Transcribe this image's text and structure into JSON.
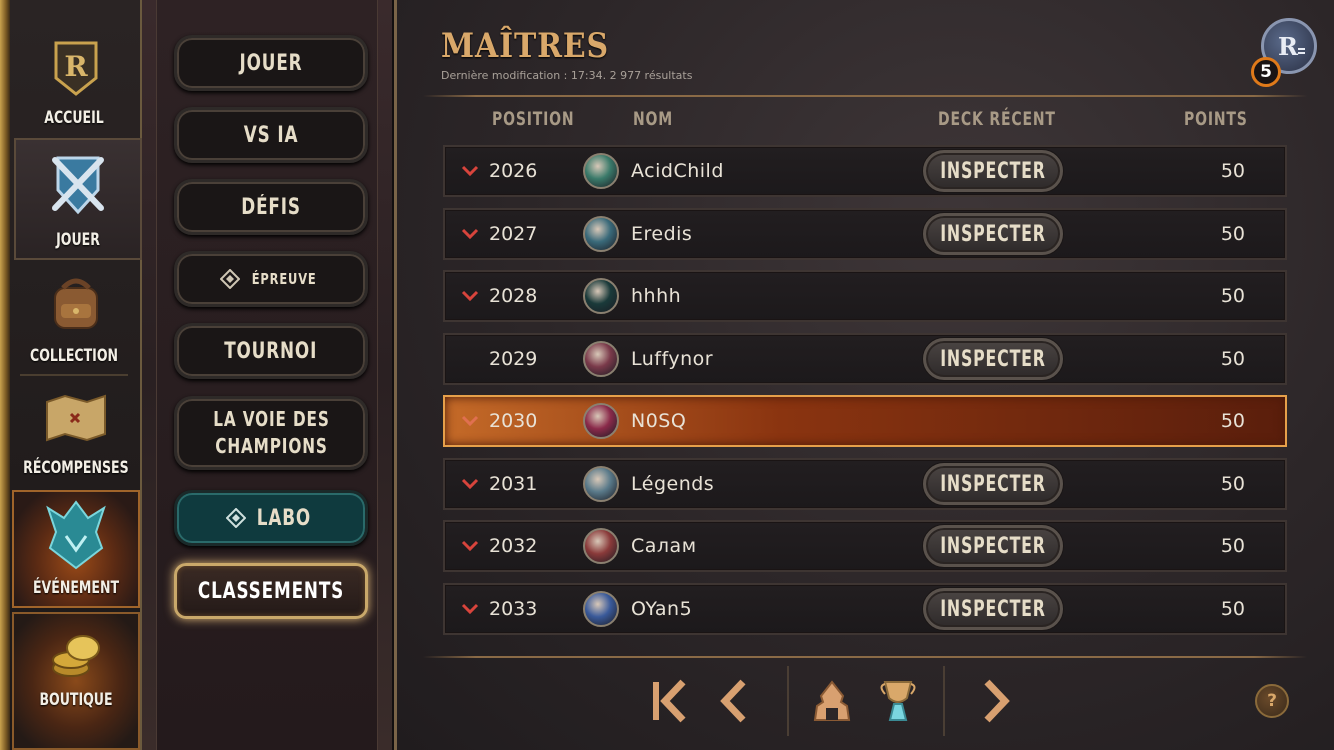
{
  "rail": {
    "items": [
      {
        "label": "ACCUEIL",
        "icon": "legends-of-runeterra-logo-icon"
      },
      {
        "label": "JOUER",
        "icon": "crossed-swords-shield-icon"
      },
      {
        "label": "COLLECTION",
        "icon": "backpack-icon"
      },
      {
        "label": "RÉCOMPENSES",
        "icon": "treasure-map-icon"
      },
      {
        "label": "ÉVÉNEMENT",
        "icon": "dragon-crest-icon"
      },
      {
        "label": "BOUTIQUE",
        "icon": "coins-icon"
      }
    ]
  },
  "menu": {
    "jouer": "JOUER",
    "vs_ia": "VS IA",
    "defis": "DÉFIS",
    "epreuve": "ÉPREUVE",
    "tournoi": "TOURNOI",
    "voie_line1": "LA VOIE DES",
    "voie_line2": "CHAMPIONS",
    "labo": "LABO",
    "classements": "CLASSEMENTS"
  },
  "main": {
    "title": "MAÎTRES",
    "subtitle": "Dernière modification : 17:34. 2 977 résultats",
    "profile_badge": "5",
    "columns": {
      "position": "POSITION",
      "name": "NOM",
      "deck": "DECK RÉCENT",
      "points": "POINTS"
    },
    "inspect_label": "INSPECTER",
    "help": "?"
  },
  "rows": [
    {
      "position": "2026",
      "name": "AcidChild",
      "points": "50",
      "trend": "down",
      "inspect": true,
      "highlight": false
    },
    {
      "position": "2027",
      "name": "Eredis",
      "points": "50",
      "trend": "down",
      "inspect": true,
      "highlight": false
    },
    {
      "position": "2028",
      "name": "hhhh",
      "points": "50",
      "trend": "down",
      "inspect": false,
      "highlight": false
    },
    {
      "position": "2029",
      "name": "Luffynor",
      "points": "50",
      "trend": "none",
      "inspect": true,
      "highlight": false
    },
    {
      "position": "2030",
      "name": "N0SQ",
      "points": "50",
      "trend": "down",
      "inspect": false,
      "highlight": true
    },
    {
      "position": "2031",
      "name": "Légends",
      "points": "50",
      "trend": "down",
      "inspect": true,
      "highlight": false
    },
    {
      "position": "2032",
      "name": "Салам",
      "points": "50",
      "trend": "down",
      "inspect": true,
      "highlight": false
    },
    {
      "position": "2033",
      "name": "OYan5",
      "points": "50",
      "trend": "down",
      "inspect": true,
      "highlight": false
    }
  ],
  "colors": {
    "accent": "#d9a86a",
    "highlight_row": "#c46a28",
    "trend_down": "#d8443c",
    "labo": "#0f3a3e"
  }
}
